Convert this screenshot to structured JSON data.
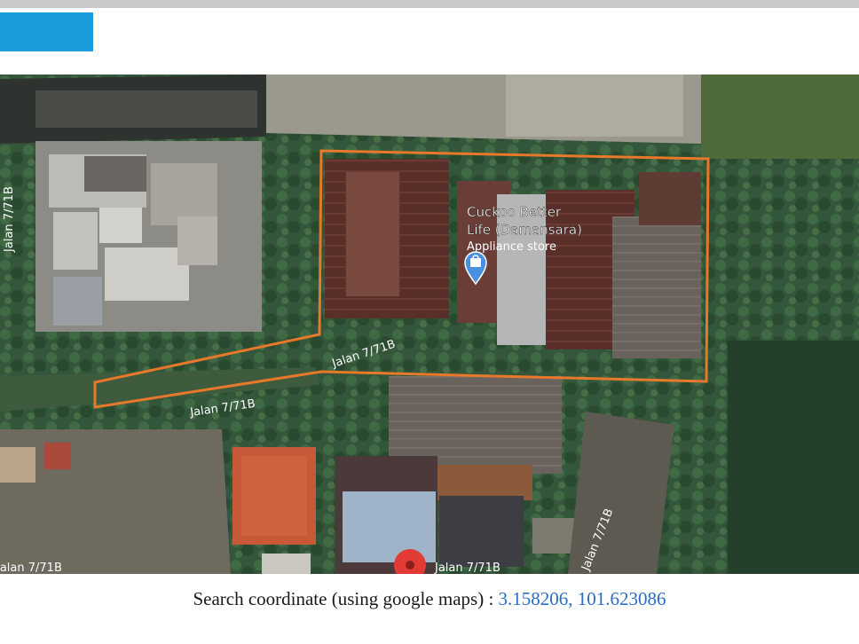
{
  "header": {
    "accent": "#1a9ddc"
  },
  "map": {
    "place_name_line1": "Cuckoo Better",
    "place_name_line2": "Life (Damansara)",
    "place_category": "Appliance store",
    "place_icon": "shopping-bag-icon",
    "pin_icon": "map-pin-icon",
    "road_labels": [
      "Jalan 7/71B",
      "Jalan 7/71B",
      "Jalan 7/71B",
      "Jalan 7/71B",
      "Jalan 7/71B",
      "Jalan 7/71B"
    ],
    "outline_color": "#e8782a"
  },
  "caption": {
    "label": "Search coordinate (using google maps) : ",
    "coordinates": "3.158206, 101.623086",
    "coord_color": "#2a6cc8"
  }
}
